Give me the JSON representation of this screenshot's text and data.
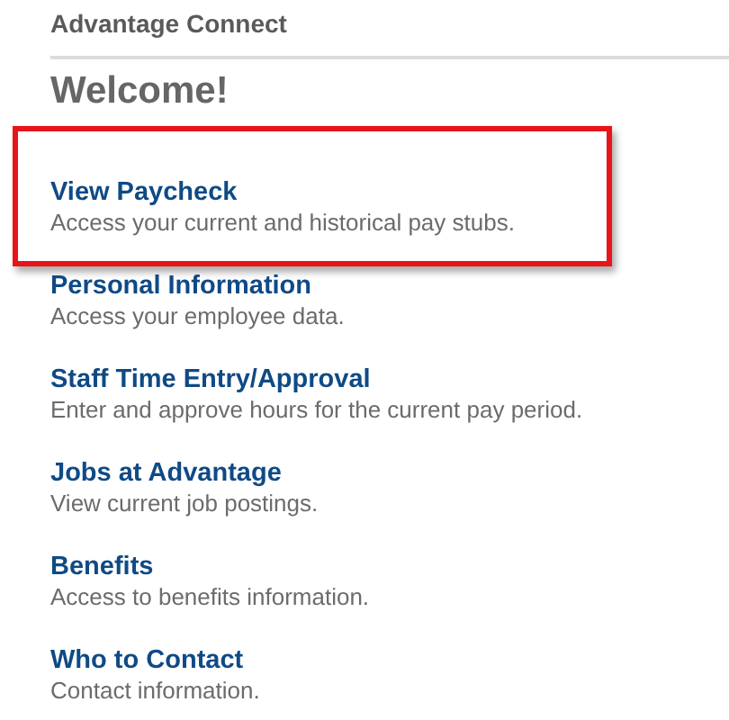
{
  "header": {
    "title": "Advantage Connect"
  },
  "heading": "Welcome!",
  "links": [
    {
      "title": "View Paycheck",
      "description": "Access your current and historical pay stubs.",
      "highlighted": true
    },
    {
      "title": "Personal Information",
      "description": "Access your employee data.",
      "highlighted": false
    },
    {
      "title": "Staff Time Entry/Approval",
      "description": "Enter and approve hours for the current pay period.",
      "highlighted": false
    },
    {
      "title": "Jobs at Advantage",
      "description": "View current job postings.",
      "highlighted": false
    },
    {
      "title": "Benefits",
      "description": "Access to benefits information.",
      "highlighted": false
    },
    {
      "title": "Who to Contact",
      "description": "Contact information.",
      "highlighted": false
    }
  ]
}
